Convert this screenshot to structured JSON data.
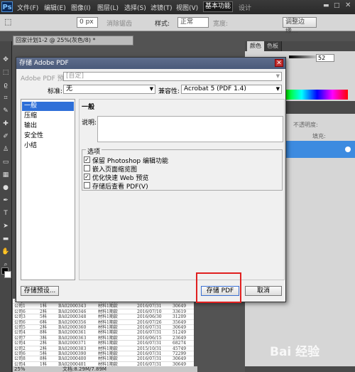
{
  "menubar": {
    "logo": "Ps",
    "items": [
      "文件(F)",
      "编辑(E)",
      "图像(I)",
      "图层(L)",
      "选择(S)",
      "滤镜(T)",
      "视图(V)",
      "窗口(W)"
    ],
    "zoom": "100%",
    "workspace": "基本功能",
    "ws_other": "设计"
  },
  "options": {
    "feather": "0 px",
    "antialias": "消除锯齿",
    "style_label": "样式:",
    "style_value": "正常",
    "width_label": "宽度:",
    "refine": "调整边缘..."
  },
  "doc": {
    "tab": "回家计划1-2 @ 25%(灰色/8) *",
    "zoom": "25%",
    "size": "文档:8.29M/7.89M"
  },
  "panels": {
    "tab1": "颜色",
    "tab2": "色板",
    "opacity": "52",
    "layers_opacity": "不透明度:",
    "fill": "填充:"
  },
  "dialog": {
    "title": "存储 Adobe PDF",
    "preset_label": "Adobe PDF 预设:",
    "preset_value": "[自定]",
    "standard_label": "标准:",
    "standard_value": "无",
    "compat_label": "兼容性:",
    "compat_value": "Acrobat 5 (PDF 1.4)",
    "sidebar": [
      "一般",
      "压缩",
      "输出",
      "安全性",
      "小结"
    ],
    "section_title": "一般",
    "desc_label": "说明:",
    "options_title": "选项",
    "checkboxes": [
      {
        "label": "保留 Photoshop 编辑功能",
        "checked": true
      },
      {
        "label": "嵌入页面缩览图",
        "checked": false
      },
      {
        "label": "优化快速 Web 预览",
        "checked": true
      },
      {
        "label": "存储后查看 PDF(V)",
        "checked": false
      }
    ],
    "save_preset": "存储预设...",
    "save_pdf": "存储 PDF",
    "cancel": "取消"
  },
  "sheet_rows": [
    [
      "公司6",
      "6科",
      "BA02000339",
      "材料1期款",
      "2015/07/01",
      "20615"
    ],
    [
      "公司1",
      "1科",
      "BA02000343",
      "材料1期款",
      "2016/07/31",
      "30649"
    ],
    [
      "公司6",
      "2科",
      "BA02000346",
      "材料1期款",
      "2016/07/10",
      "33619"
    ],
    [
      "公司3",
      "5科",
      "BA02000348",
      "材料1期款",
      "2016/06/30",
      "31209"
    ],
    [
      "公司6",
      "6科",
      "BA02000356",
      "材料1期款",
      "2016/07/26",
      "35649"
    ],
    [
      "公司5",
      "2科",
      "BA02000360",
      "材料1期款",
      "2016/07/31",
      "30649"
    ],
    [
      "公司4",
      "8科",
      "BA02000361",
      "材料1期款",
      "2016/07/31",
      "51249"
    ],
    [
      "公司7",
      "3科",
      "BA02000363",
      "材料1期款",
      "2016/06/15",
      "23649"
    ],
    [
      "公司4",
      "2科",
      "BA02000371",
      "材料1期款",
      "2016/07/31",
      "68274"
    ],
    [
      "公司2",
      "2科",
      "BA02000383",
      "材料1期款",
      "2015/10/31",
      "45749"
    ],
    [
      "公司6",
      "5科",
      "BA02000390",
      "材料1期款",
      "2016/07/31",
      "72299"
    ],
    [
      "公司8",
      "8科",
      "BA02000400",
      "材料1期款",
      "2016/07/31",
      "30649"
    ],
    [
      "公司4",
      "1科",
      "BA02000401",
      "材料1期款",
      "2016/07/31",
      "30649"
    ]
  ],
  "watermark": "Bai 经验"
}
